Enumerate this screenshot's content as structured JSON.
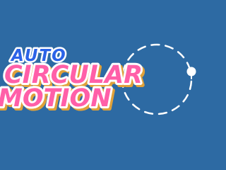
{
  "title": {
    "line1": "AUTO",
    "line2": "CIRCULAR",
    "line3": "MOTION"
  },
  "colors": {
    "background": "#2d6aa3",
    "auto_text": "#2b63e8",
    "main_text": "#ff5fa8",
    "outline": "#ffffff",
    "shadow": "#e0a13a",
    "orbit": "#ffffff"
  },
  "icons": {
    "orbit": "dashed-circle-path-icon",
    "ball": "white-ball-icon"
  }
}
